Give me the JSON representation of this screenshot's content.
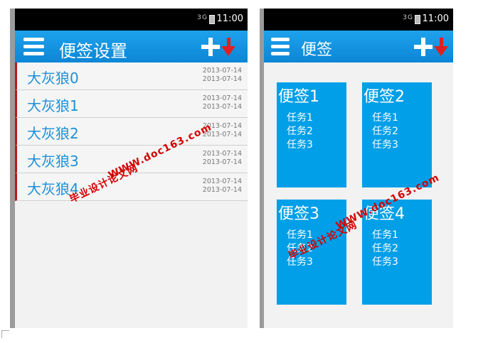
{
  "status_bar": {
    "signal": "3G",
    "time": "11:00"
  },
  "list_screen": {
    "title": "便签设置",
    "notes": [
      {
        "name": "大灰狼0",
        "date_created": "2013-07-14",
        "date_modified": "2013-07-14"
      },
      {
        "name": "大灰狼1",
        "date_created": "2013-07-14",
        "date_modified": "2013-07-14"
      },
      {
        "name": "大灰狼2",
        "date_created": "2013-07-14",
        "date_modified": "2013-07-14"
      },
      {
        "name": "大灰狼3",
        "date_created": "2013-07-14",
        "date_modified": "2013-07-14"
      },
      {
        "name": "大灰狼4",
        "date_created": "2013-07-14",
        "date_modified": "2013-07-14"
      }
    ]
  },
  "grid_screen": {
    "title": "便签",
    "cards": [
      {
        "title": "便签1",
        "tasks": [
          "任务1",
          "任务2",
          "任务3"
        ]
      },
      {
        "title": "便签2",
        "tasks": [
          "任务1",
          "任务2",
          "任务3"
        ]
      },
      {
        "title": "便签3",
        "tasks": [
          "任务1",
          "任务2",
          "任务3"
        ]
      },
      {
        "title": "便签4",
        "tasks": [
          "任务1",
          "任务2",
          "任务3"
        ]
      }
    ]
  },
  "watermark": {
    "site": "WWW.doc163.com",
    "name": "毕业设计论文网"
  },
  "colors": {
    "appbar": "#1a98e4",
    "card": "#009fe8",
    "accent_bar": "#b8171b",
    "arrow": "#e02020"
  },
  "icons": {
    "menu": "menu-icon",
    "add": "plus-icon",
    "sort": "arrow-down-icon"
  }
}
